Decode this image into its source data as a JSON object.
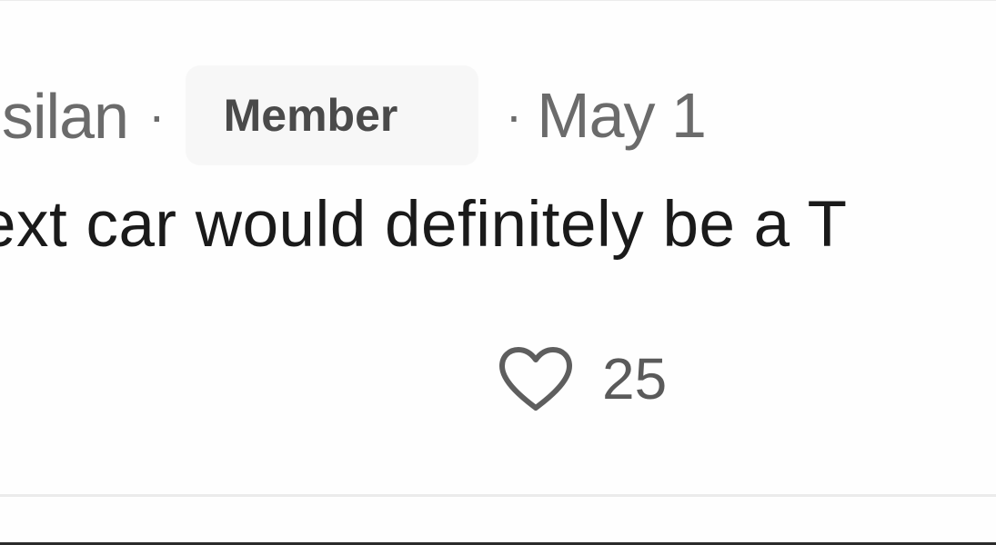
{
  "comment": {
    "author": "silan",
    "separator": "·",
    "badge": "Member",
    "date": "May 1",
    "text": "ext car would definitely be a T",
    "like_count": "25",
    "like_icon": "heart-outline-icon"
  }
}
